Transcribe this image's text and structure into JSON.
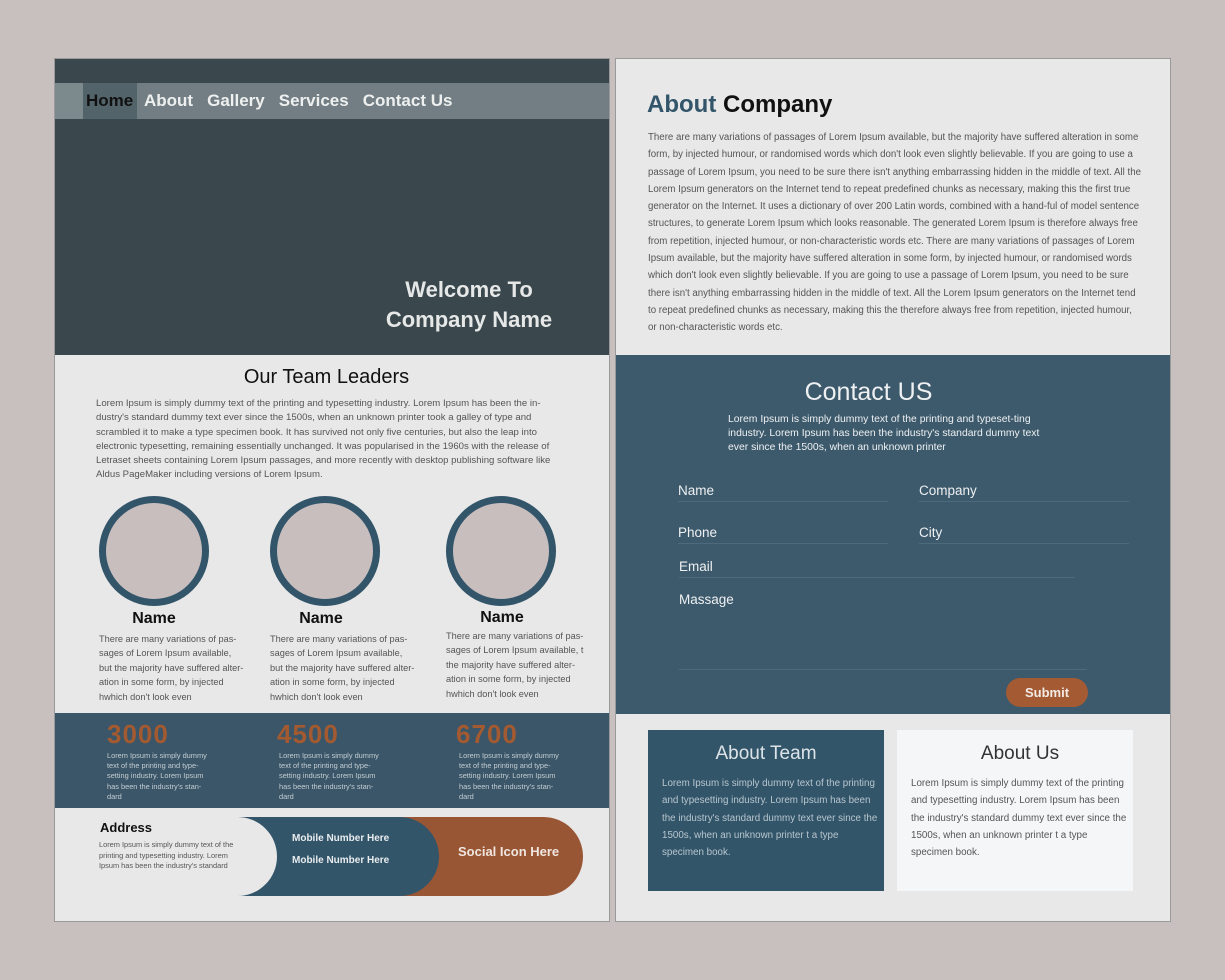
{
  "nav": {
    "items": [
      {
        "label": "Home",
        "active": true
      },
      {
        "label": "About",
        "active": false
      },
      {
        "label": "Gallery",
        "active": false
      },
      {
        "label": "Services",
        "active": false
      },
      {
        "label": "Contact Us",
        "active": false
      }
    ]
  },
  "hero": {
    "line1": "Welcome To",
    "line2": "Company Name"
  },
  "team": {
    "title": "Our Team Leaders",
    "intro": "Lorem Ipsum is simply dummy text of the printing and typesetting industry. Lorem Ipsum has been the in-dustry's standard dummy text ever since the 1500s, when an unknown printer took a galley of type and scrambled it to make a type specimen book. It has survived not only five centuries, but also the leap into electronic typesetting, remaining essentially unchanged. It was popularised in the 1960s with the release of Letraset sheets containing Lorem Ipsum passages, and more recently with desktop publishing software like Aldus PageMaker including versions of Lorem Ipsum.",
    "leaders": [
      {
        "name": "Name",
        "desc": "There are many variations of pas-sages of Lorem Ipsum available, but the majority have suffered alter-ation in some form, by injected hwhich don't look even"
      },
      {
        "name": "Name",
        "desc": "There are many variations of pas-sages of Lorem Ipsum available, but the majority have suffered alter-ation in some form, by injected hwhich don't look even"
      },
      {
        "name": "Name",
        "desc": "There are many variations of pas-sages of Lorem Ipsum available, t the majority have suffered alter-ation in some form, by injected hwhich don't look even"
      }
    ]
  },
  "stats": [
    {
      "value": "3000",
      "desc": "Lorem Ipsum is simply dummy text of the printing and type-setting industry. Lorem Ipsum has been the industry's stan-dard"
    },
    {
      "value": "4500",
      "desc": "Lorem Ipsum is simply dummy text of the printing and type-setting industry. Lorem Ipsum has been the industry's stan-dard"
    },
    {
      "value": "6700",
      "desc": "Lorem Ipsum is simply dummy text of the printing and type-setting industry. Lorem Ipsum has been the industry's stan-dard"
    }
  ],
  "footer": {
    "address_title": "Address",
    "address_text": "Lorem Ipsum is simply dummy text of the printing and typesetting industry. Lorem Ipsum has been the industry's standard",
    "mobile1": "Mobile Number Here",
    "mobile2": "Mobile Number Here",
    "social": "Social  Icon Here"
  },
  "about": {
    "title_accent": "About",
    "title_rest": "Company",
    "text": "There are many variations of passages of Lorem Ipsum available, but the majority have suffered alteration in some form, by injected humour, or randomised words which don't look even slightly believable. If you are going to use a passage of Lorem Ipsum, you need to be sure there isn't anything embarrassing hidden in the middle of text. All the Lorem Ipsum generators on the Internet tend to repeat predefined chunks as necessary, making this the first true generator on the Internet. It uses a dictionary of over 200 Latin words, combined with a hand-ful of model sentence structures, to generate Lorem Ipsum which looks reasonable. The generated Lorem Ipsum is therefore always free from repetition, injected humour, or non-characteristic words etc. There are many variations of passages of Lorem Ipsum available, but the majority have suffered alteration in some form, by injected humour, or randomised words which don't look even slightly believable. If you are going to use a passage of Lorem Ipsum, you need to be sure there isn't anything embarrassing hidden in the middle of text. All the Lorem Ipsum generators on the Internet tend to repeat predefined chunks as necessary, making this the therefore always free from repetition, injected humour, or non-characteristic words etc."
  },
  "contact": {
    "title": "Contact US",
    "text": "Lorem Ipsum is simply dummy text of the printing and typeset-ting industry. Lorem Ipsum has been the industry's standard dummy text ever since the 1500s, when an unknown printer",
    "fields": {
      "name": "Name",
      "company": "Company",
      "phone": "Phone",
      "city": "City",
      "email": "Email",
      "message": "Massage"
    },
    "submit": "Submit"
  },
  "cards": {
    "team_title": "About Team",
    "team_text": "Lorem Ipsum is simply dummy text of the printing and typesetting industry. Lorem Ipsum has been the industry's standard dummy text ever since the 1500s, when an unknown printer t a type specimen book.",
    "us_title": "About Us",
    "us_text": "Lorem Ipsum is simply dummy text of the printing and typesetting industry. Lorem Ipsum has been the industry's standard dummy text ever since the 1500s, when an unknown printer t a type specimen book."
  },
  "colors": {
    "hero_bg": "#3a474c",
    "nav_bg": "#727e83",
    "primary_blue": "#33556a",
    "accent_orange": "#a45a33",
    "page_bg": "#e8e8e8",
    "canvas_bg": "#c8bfbf"
  }
}
